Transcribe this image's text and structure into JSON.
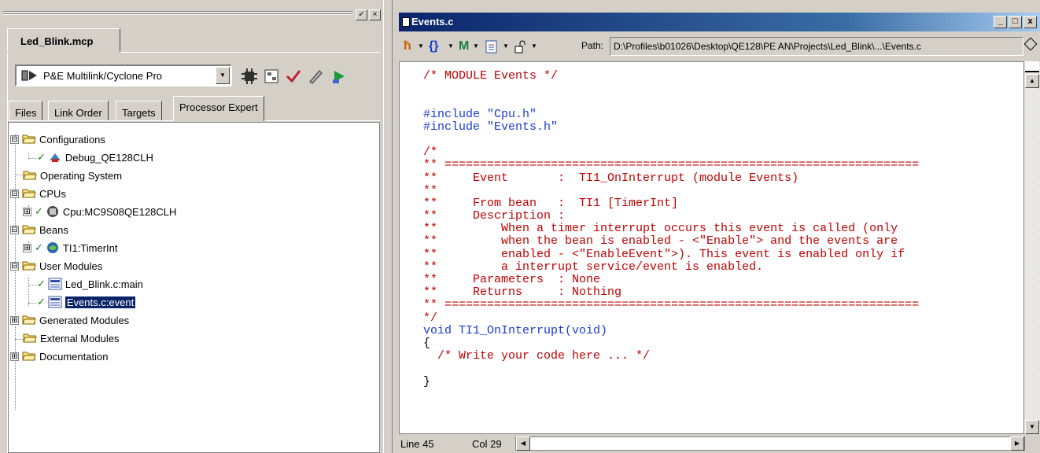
{
  "project_panel": {
    "tab_label": "Led_Blink.mcp",
    "target": "P&E Multilink/Cyclone Pro",
    "tabs": [
      "Files",
      "Link Order",
      "Targets",
      "Processor Expert"
    ],
    "active_tab": "Processor Expert",
    "tree": [
      {
        "label": "Configurations",
        "expander": "⊟",
        "type": "folder"
      },
      {
        "label": "Debug_QE128CLH",
        "type": "config",
        "checked": true
      },
      {
        "label": "Operating System",
        "type": "folder"
      },
      {
        "label": "CPUs",
        "expander": "⊟",
        "type": "folder"
      },
      {
        "label": "Cpu:MC9S08QE128CLH",
        "expander": "⊞",
        "type": "cpu",
        "checked": true
      },
      {
        "label": "Beans",
        "expander": "⊟",
        "type": "folder"
      },
      {
        "label": "TI1:TimerInt",
        "expander": "⊞",
        "type": "bean",
        "checked": true
      },
      {
        "label": "User Modules",
        "expander": "⊟",
        "type": "folder"
      },
      {
        "label": "Led_Blink.c:main",
        "type": "module",
        "checked": true
      },
      {
        "label": "Events.c:event",
        "type": "module",
        "checked": true,
        "selected": true
      },
      {
        "label": "Generated Modules",
        "expander": "⊞",
        "type": "folder"
      },
      {
        "label": "External Modules",
        "type": "folder"
      },
      {
        "label": "Documentation",
        "expander": "⊞",
        "type": "folder"
      }
    ]
  },
  "editor": {
    "title": "Events.c",
    "window_buttons": [
      "_",
      "□",
      "x"
    ],
    "toolbar": {
      "path_label": "Path:",
      "path": "D:\\Profiles\\b01026\\Desktop\\QE128\\PE AN\\Projects\\Led_Blink\\...\\Events.c"
    },
    "code": [
      {
        "t": "/* MODULE Events */",
        "c": "com"
      },
      {
        "t": "",
        "c": ""
      },
      {
        "t": "",
        "c": ""
      },
      {
        "t": "#include \"Cpu.h\"",
        "c": "inc"
      },
      {
        "t": "#include \"Events.h\"",
        "c": "inc"
      },
      {
        "t": "",
        "c": ""
      },
      {
        "t": "/*",
        "c": "com"
      },
      {
        "t": "** ===================================================================",
        "c": "com"
      },
      {
        "t": "**     Event       :  TI1_OnInterrupt (module Events)",
        "c": "com"
      },
      {
        "t": "**",
        "c": "com"
      },
      {
        "t": "**     From bean   :  TI1 [TimerInt]",
        "c": "com"
      },
      {
        "t": "**     Description :",
        "c": "com"
      },
      {
        "t": "**         When a timer interrupt occurs this event is called (only",
        "c": "com"
      },
      {
        "t": "**         when the bean is enabled - <\"Enable\"> and the events are",
        "c": "com"
      },
      {
        "t": "**         enabled - <\"EnableEvent\">). This event is enabled only if",
        "c": "com"
      },
      {
        "t": "**         a interrupt service/event is enabled.",
        "c": "com"
      },
      {
        "t": "**     Parameters  : None",
        "c": "com"
      },
      {
        "t": "**     Returns     : Nothing",
        "c": "com"
      },
      {
        "t": "** ===================================================================",
        "c": "com"
      },
      {
        "t": "*/",
        "c": "com"
      },
      {
        "t": "void TI1_OnInterrupt(void)",
        "c": "fn"
      },
      {
        "t": "{",
        "c": ""
      },
      {
        "t": "  /* Write your code here ... */",
        "c": "com"
      },
      {
        "t": "",
        "c": ""
      },
      {
        "t": "}",
        "c": ""
      }
    ],
    "status": {
      "line": "Line 45",
      "col": "Col 29"
    }
  }
}
